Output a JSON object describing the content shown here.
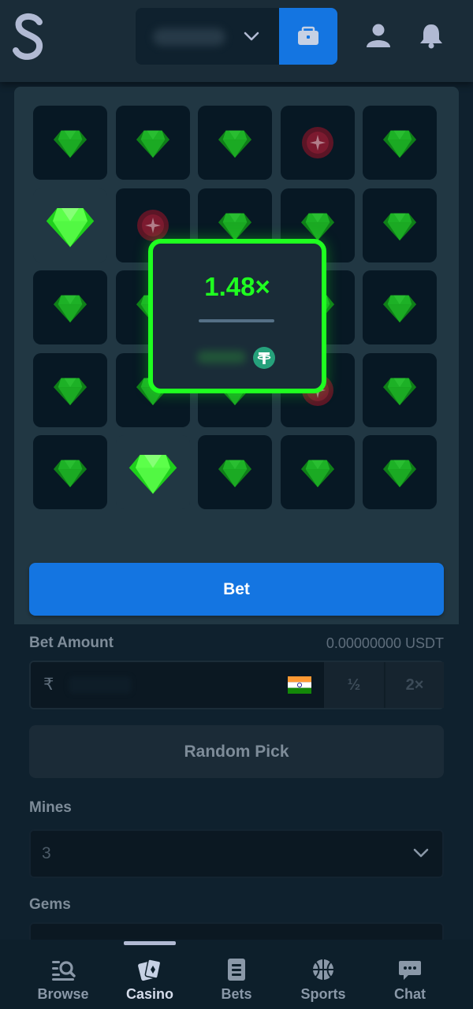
{
  "header": {
    "logo_alt": "S",
    "wallet_icon": "wallet-icon",
    "profile_icon": "user-icon",
    "notifications_icon": "bell-icon"
  },
  "game": {
    "grid": [
      [
        "gem",
        "gem",
        "gem",
        "mine",
        "gem"
      ],
      [
        "gem-revealed",
        "mine",
        "gem",
        "gem",
        "gem"
      ],
      [
        "gem",
        "gem",
        "gem",
        "gem",
        "gem"
      ],
      [
        "gem",
        "gem",
        "gem",
        "mine",
        "gem"
      ],
      [
        "gem",
        "gem-revealed",
        "gem",
        "gem",
        "gem"
      ]
    ],
    "bet_button_label": "Bet",
    "win_popup": {
      "multiplier": "1.48×",
      "currency_icon": "usdt-icon"
    },
    "colors": {
      "accent_green": "#1fff20",
      "primary_blue": "#1475e1"
    }
  },
  "settings": {
    "bet_amount_label": "Bet Amount",
    "bet_amount_value": "0.00000000 USDT",
    "currency_symbol": "₹",
    "half_label": "½",
    "double_label": "2×",
    "random_pick_label": "Random Pick",
    "mines_label": "Mines",
    "mines_value": "3",
    "gems_label": "Gems"
  },
  "nav": {
    "items": [
      {
        "label": "Browse",
        "icon": "browse-icon"
      },
      {
        "label": "Casino",
        "icon": "casino-icon"
      },
      {
        "label": "Bets",
        "icon": "bets-icon"
      },
      {
        "label": "Sports",
        "icon": "sports-icon"
      },
      {
        "label": "Chat",
        "icon": "chat-icon"
      }
    ],
    "active": "Casino"
  }
}
